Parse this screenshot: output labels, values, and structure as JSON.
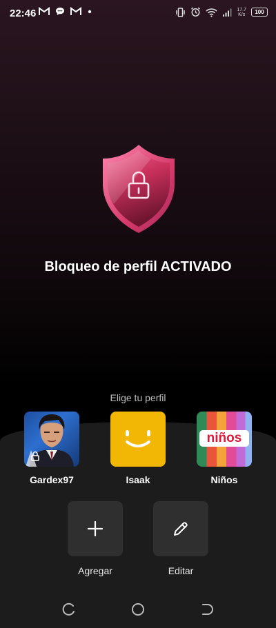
{
  "status_bar": {
    "time": "22:46",
    "left_icons": [
      "gmail-icon",
      "chat-bubble-icon",
      "gmail-icon",
      "dot-icon"
    ],
    "right_icons": [
      "vibrate-icon",
      "alarm-icon",
      "wifi-icon",
      "signal-icon"
    ],
    "net_speed_value": "17.7",
    "net_speed_unit": "K/s",
    "battery": "100"
  },
  "hero": {
    "headline": "Bloqueo de perfil ACTIVADO",
    "icon": "shield-lock-icon",
    "colors": {
      "shield_top": "#e5447a",
      "shield_bottom": "#8c1f3c"
    }
  },
  "profiles": {
    "prompt": "Elige tu perfil",
    "items": [
      {
        "name": "Gardex97",
        "avatar": "character-portrait",
        "locked": true
      },
      {
        "name": "Isaak",
        "avatar": "smiley-face-yellow"
      },
      {
        "name": "Niños",
        "avatar": "kids-rainbow",
        "avatar_text": "niños"
      }
    ]
  },
  "actions": [
    {
      "label": "Agregar",
      "icon": "plus-icon"
    },
    {
      "label": "Editar",
      "icon": "pencil-icon"
    }
  ],
  "nav": [
    "recents-icon",
    "home-icon",
    "back-icon"
  ]
}
